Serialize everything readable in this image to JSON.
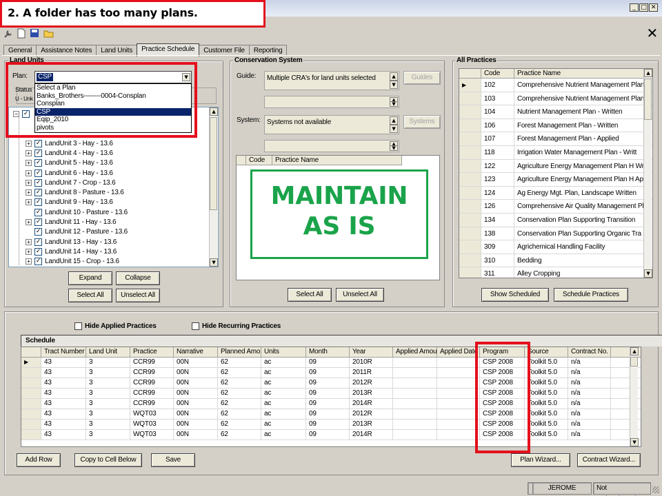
{
  "callout": {
    "text": "2.  A folder has too many plans."
  },
  "window": {
    "min": "_",
    "max": "□",
    "close": "✕",
    "doc_close": "✕"
  },
  "tabs": [
    "General",
    "Assistance Notes",
    "Land Units",
    "Practice Schedule",
    "Customer File",
    "Reporting"
  ],
  "land_units": {
    "title": "Land Units",
    "plan_label": "Plan:",
    "plan_value": "CSP",
    "status_label": "Status",
    "status_sub": "U - Unk",
    "dropdown_options": [
      "Select a Plan",
      "Banks_Brothers--------0004-Consplan",
      "Consplan",
      "CSP",
      "Eqip_2010",
      "pivots"
    ],
    "items": [
      "LandUnit 3 - Hay - 13.6",
      "LandUnit 4 - Hay - 13.6",
      "LandUnit 5 - Hay - 13.6",
      "LandUnit 6 - Hay - 13.6",
      "LandUnit 7 - Crop - 13.6",
      "LandUnit 8 - Pasture - 13.6",
      "LandUnit 9 - Hay - 13.6",
      "LandUnit 10 - Pasture - 13.6",
      "LandUnit 11 - Hay - 13.6",
      "LandUnit 12 - Pasture - 13.6",
      "LandUnit 13 - Hay - 13.6",
      "LandUnit 14 - Hay - 13.6",
      "LandUnit 15 - Crop - 13.6"
    ],
    "expand": "Expand",
    "collapse": "Collapse",
    "select_all": "Select All",
    "unselect_all": "Unselect All"
  },
  "conservation": {
    "title": "Conservation System",
    "guide_label": "Guide:",
    "guide_text": "Multiple CRA's for land units selected",
    "guides_btn": "Guides",
    "system_label": "System:",
    "system_text": "Systems not available",
    "systems_btn": "Systems",
    "col_code": "Code",
    "col_name": "Practice Name",
    "overlay_line1": "MAINTAIN",
    "overlay_line2": "AS IS",
    "select_all": "Select All",
    "unselect_all": "Unselect All"
  },
  "all_practices": {
    "title": "All Practices",
    "col_code": "Code",
    "col_name": "Practice Name",
    "rows": [
      {
        "code": "102",
        "name": "Comprehensive Nutrient Management Plan -"
      },
      {
        "code": "103",
        "name": "Comprehensive Nutrient Management Plan -"
      },
      {
        "code": "104",
        "name": "Nutrient Management Plan - Written"
      },
      {
        "code": "106",
        "name": "Forest Management Plan - Written"
      },
      {
        "code": "107",
        "name": "Forest Management Plan - Applied"
      },
      {
        "code": "118",
        "name": "Irrigation Water Management Plan - Writt"
      },
      {
        "code": "122",
        "name": "Agriculture Energy Management Plan H Wri"
      },
      {
        "code": "123",
        "name": "Agriculture Energy Management Plan H App"
      },
      {
        "code": "124",
        "name": "Ag Energy Mgt. Plan, Landscape Written"
      },
      {
        "code": "126",
        "name": "Comprehensive Air Quality Management Pla"
      },
      {
        "code": "134",
        "name": "Conservation Plan Supporting Transition"
      },
      {
        "code": "138",
        "name": "Conservation Plan Supporting Organic Tra"
      },
      {
        "code": "309",
        "name": "Agrichemical Handling Facility"
      },
      {
        "code": "310",
        "name": "Bedding"
      },
      {
        "code": "311",
        "name": "Alley Cropping"
      }
    ],
    "show_scheduled": "Show Scheduled",
    "schedule_practices": "Schedule Practices"
  },
  "schedule": {
    "hide_applied": "Hide Applied Practices",
    "hide_recurring": "Hide Recurring Practices",
    "tab": "Schedule",
    "columns": [
      "Tract Number",
      "Land Unit",
      "Practice",
      "Narrative",
      "Planned Amo",
      "Units",
      "Month",
      "Year",
      "Applied Amou",
      "Applied Date",
      "Program",
      "Source",
      "Contract No."
    ],
    "rows": [
      [
        "43",
        "3",
        "CCR99",
        "00N",
        "62",
        "ac",
        "09",
        "2010R",
        "",
        "",
        "CSP 2008",
        "Toolkit 5.0",
        "n/a"
      ],
      [
        "43",
        "3",
        "CCR99",
        "00N",
        "62",
        "ac",
        "09",
        "2011R",
        "",
        "",
        "CSP 2008",
        "Toolkit 5.0",
        "n/a"
      ],
      [
        "43",
        "3",
        "CCR99",
        "00N",
        "62",
        "ac",
        "09",
        "2012R",
        "",
        "",
        "CSP 2008",
        "Toolkit 5.0",
        "n/a"
      ],
      [
        "43",
        "3",
        "CCR99",
        "00N",
        "62",
        "ac",
        "09",
        "2013R",
        "",
        "",
        "CSP 2008",
        "Toolkit 5.0",
        "n/a"
      ],
      [
        "43",
        "3",
        "CCR99",
        "00N",
        "62",
        "ac",
        "09",
        "2014R",
        "",
        "",
        "CSP 2008",
        "Toolkit 5.0",
        "n/a"
      ],
      [
        "43",
        "3",
        "WQT03",
        "00N",
        "62",
        "ac",
        "09",
        "2012R",
        "",
        "",
        "CSP 2008",
        "Toolkit 5.0",
        "n/a"
      ],
      [
        "43",
        "3",
        "WQT03",
        "00N",
        "62",
        "ac",
        "09",
        "2013R",
        "",
        "",
        "CSP 2008",
        "Toolkit 5.0",
        "n/a"
      ],
      [
        "43",
        "3",
        "WQT03",
        "00N",
        "62",
        "ac",
        "09",
        "2014R",
        "",
        "",
        "CSP 2008",
        "Toolkit 5.0",
        "n/a"
      ]
    ],
    "add_row": "Add Row",
    "copy_cell": "Copy to Cell Below",
    "save": "Save",
    "plan_wizard": "Plan Wizard...",
    "contract_wizard": "Contract Wizard..."
  },
  "statusbar": {
    "user": "JEROME KOROL",
    "auth": "Not authenticated"
  },
  "colors": {
    "red_highlight": "#e3101c",
    "overlay_green": "#1aa34a",
    "selection_blue": "#0a246a"
  }
}
